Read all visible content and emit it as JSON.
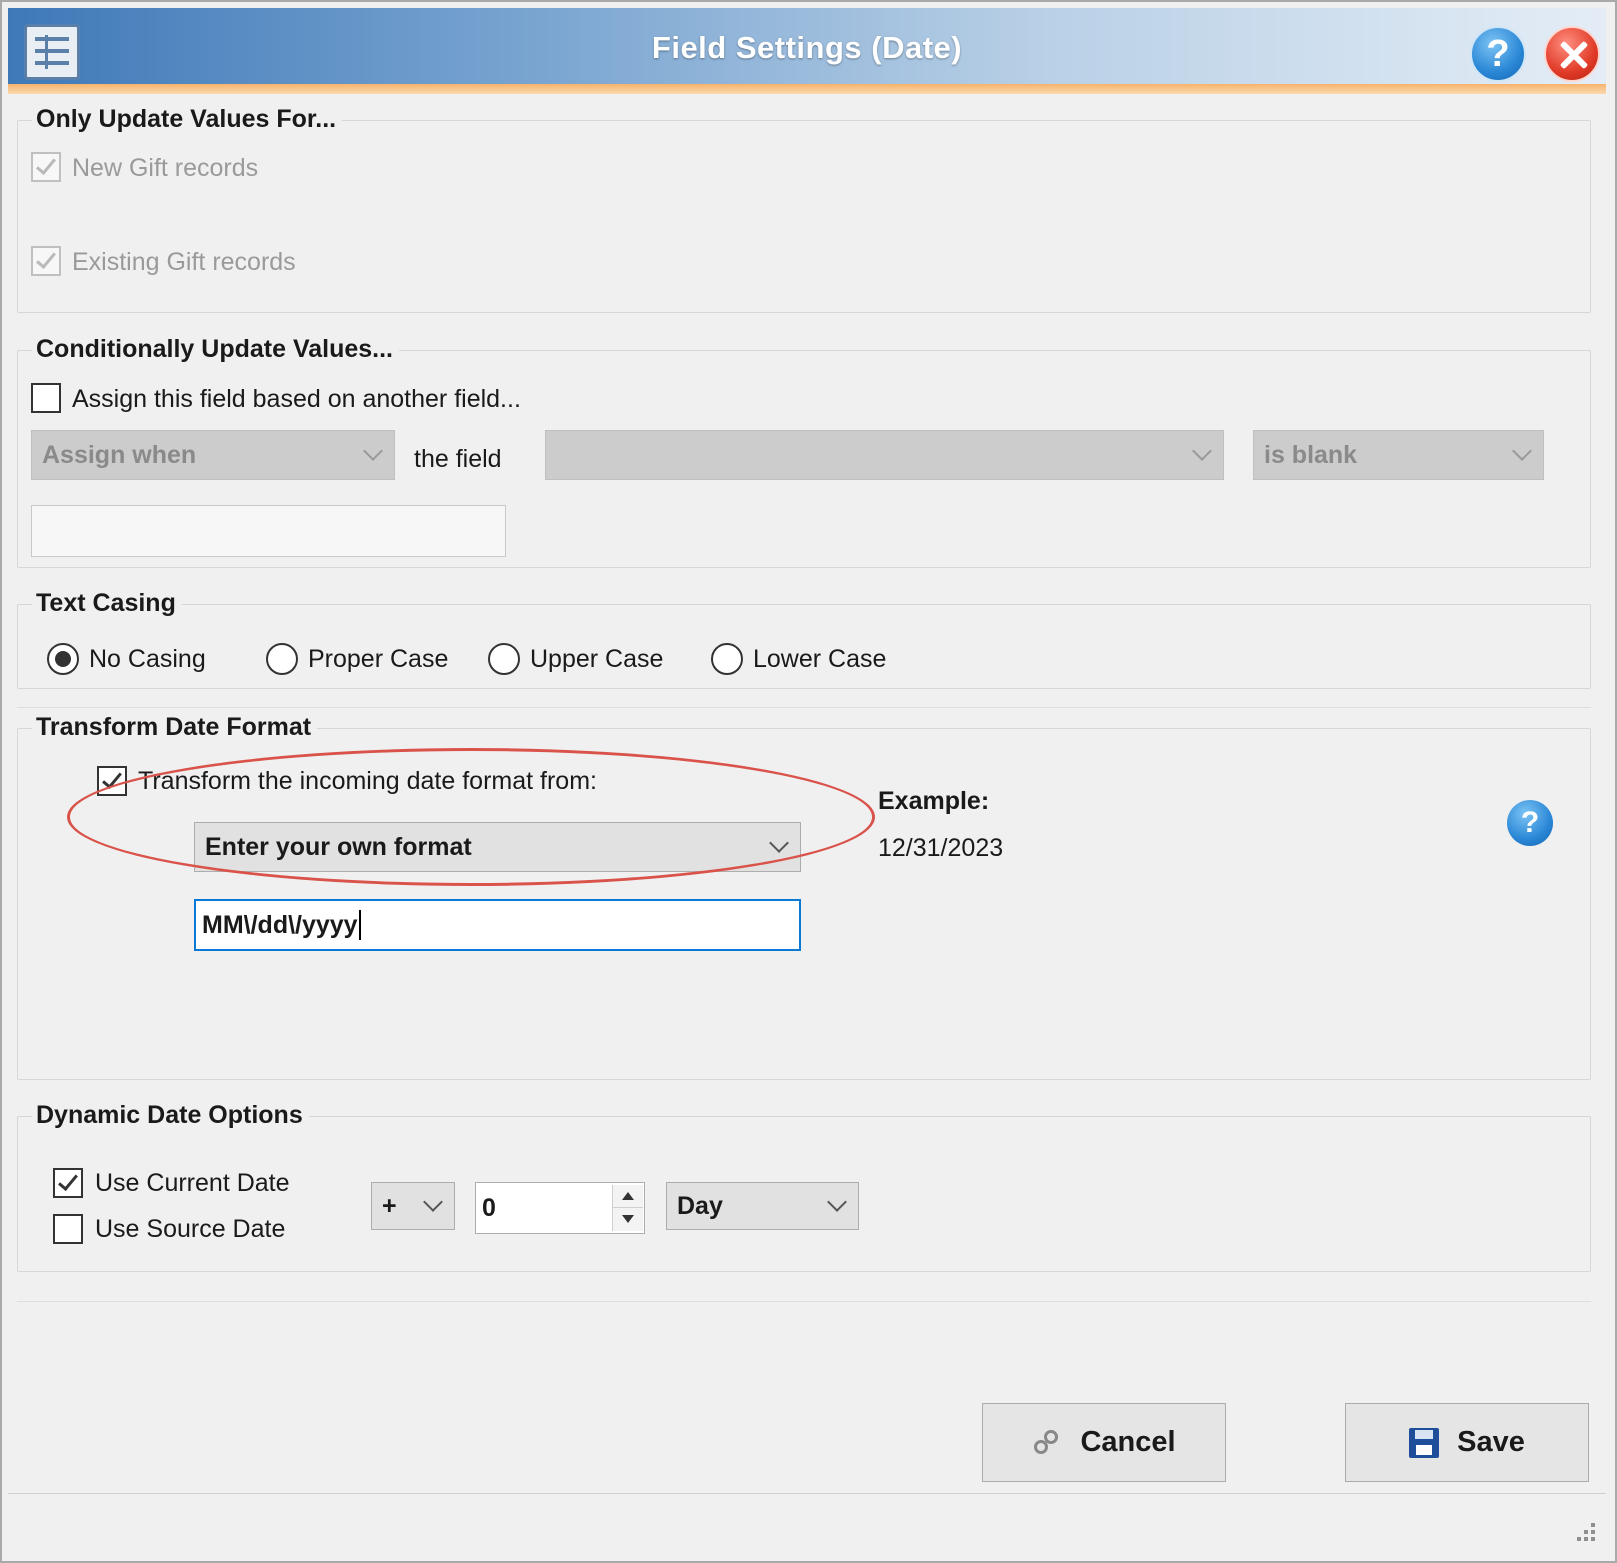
{
  "window": {
    "title": "Field Settings (Date)"
  },
  "only_update": {
    "title": "Only Update Values For...",
    "new_records": {
      "label": "New Gift records",
      "checked": true,
      "enabled": false
    },
    "existing_records": {
      "label": "Existing Gift records",
      "checked": true,
      "enabled": false
    }
  },
  "conditional": {
    "title": "Conditionally Update Values...",
    "assign_checkbox": {
      "label": "Assign this field based on another field...",
      "checked": false
    },
    "assign_when": "Assign when",
    "the_field_label": "the field",
    "field_value": "",
    "operator": "is blank",
    "value_input": ""
  },
  "text_casing": {
    "title": "Text Casing",
    "options": [
      "No Casing",
      "Proper Case",
      "Upper Case",
      "Lower Case"
    ],
    "selected": "No Casing"
  },
  "transform": {
    "title": "Transform Date Format",
    "checkbox_label": "Transform the incoming date format from:",
    "checked": true,
    "format_option": "Enter your own format",
    "format_value": "MM\\/dd\\/yyyy",
    "example_label": "Example:",
    "example_value": "12/31/2023"
  },
  "dynamic": {
    "title": "Dynamic Date Options",
    "use_current": {
      "label": "Use Current Date",
      "checked": true
    },
    "use_source": {
      "label": "Use Source Date",
      "checked": false
    },
    "sign": "+",
    "amount": "0",
    "unit": "Day"
  },
  "buttons": {
    "cancel": "Cancel",
    "save": "Save"
  },
  "colors": {
    "accent_border": "#0a78d7",
    "annotation": "#d9534a",
    "title_gradient_start": "#3f79b8"
  },
  "icons": [
    "app-table-icon",
    "help-icon",
    "close-icon",
    "link-icon",
    "save-disk-icon",
    "resize-grip-icon"
  ]
}
